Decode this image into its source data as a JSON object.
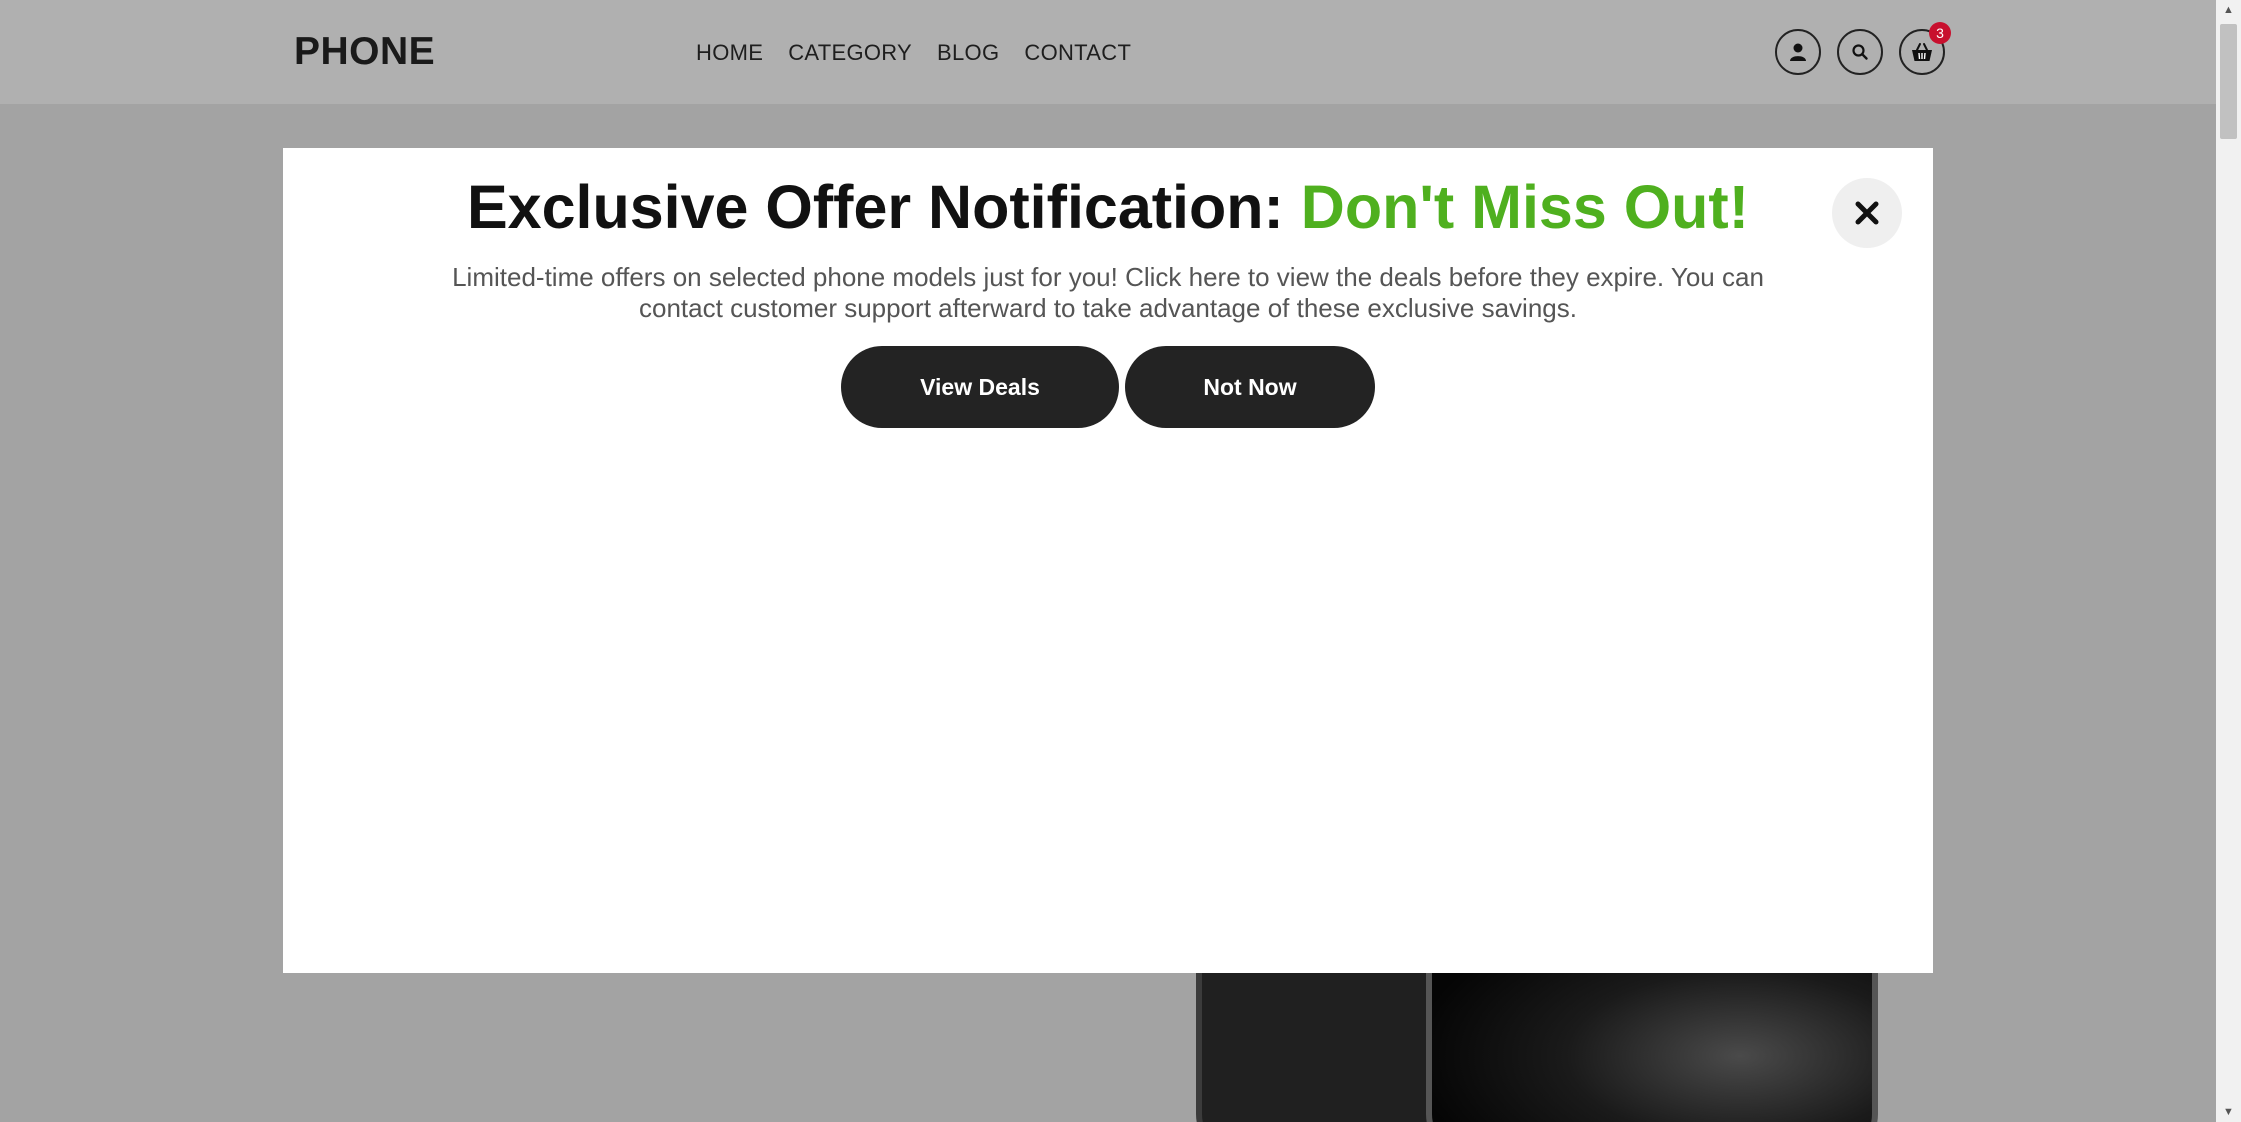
{
  "header": {
    "logo": "PHONE",
    "nav": [
      "HOME",
      "CATEGORY",
      "BLOG",
      "CONTACT"
    ],
    "icons": [
      "user-icon",
      "search-icon",
      "basket-icon"
    ],
    "cart_count": "3",
    "badge_color": "#c8102e"
  },
  "modal": {
    "title_main": "Exclusive Offer Notification: ",
    "title_accent": "Don't Miss Out!",
    "accent_color": "#4fb01f",
    "body": "Limited-time offers on selected phone models just for you! Click here to view the deals before they expire. You can contact customer support afterward to take advantage of these exclusive savings.",
    "primary_button": "View Deals",
    "secondary_button": "Not Now",
    "close_icon": "close-icon"
  }
}
